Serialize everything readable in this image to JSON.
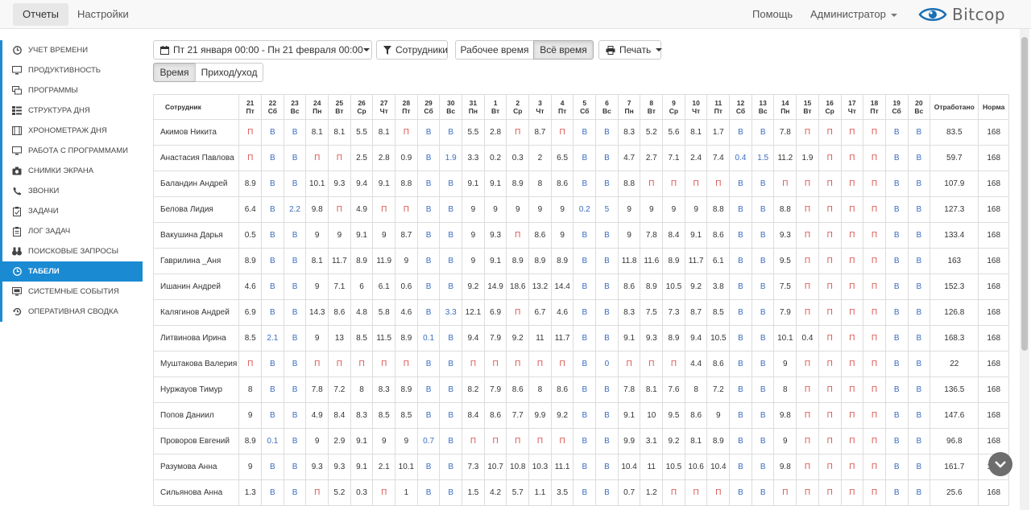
{
  "topbar": {
    "tabs": [
      "Отчеты",
      "Настройки"
    ],
    "help": "Помощь",
    "admin": "Администратор",
    "logo": "Bitcop"
  },
  "sidebar": {
    "items": [
      {
        "label": "Учет времени",
        "icon": "clock-icon"
      },
      {
        "label": "Продуктивность",
        "icon": "monitor-icon"
      },
      {
        "label": "Программы",
        "icon": "apps-icon"
      },
      {
        "label": "Структура дня",
        "icon": "list-icon"
      },
      {
        "label": "Хронометраж дня",
        "icon": "film-icon"
      },
      {
        "label": "Работа с программами",
        "icon": "monitor-icon"
      },
      {
        "label": "Снимки экрана",
        "icon": "camera-icon"
      },
      {
        "label": "Звонки",
        "icon": "phone-icon"
      },
      {
        "label": "Задачи",
        "icon": "clipboard-icon"
      },
      {
        "label": "Лог задач",
        "icon": "log-icon"
      },
      {
        "label": "Поисковые запросы",
        "icon": "binoculars-icon"
      },
      {
        "label": "Табели",
        "icon": "clock-icon"
      },
      {
        "label": "Системные события",
        "icon": "event-icon"
      },
      {
        "label": "Оперативная сводка",
        "icon": "history-icon"
      }
    ],
    "active_index": 11
  },
  "toolbar": {
    "date_range": "Пт 21 января 00:00 - Пн 21 февраля 00:00",
    "employees": "Сотрудники",
    "work_time": "Рабочее время",
    "all_time": "Всё время",
    "print": "Печать",
    "view_time": "Время",
    "view_arrival": "Приход/уход"
  },
  "table": {
    "employee_header": "Сотрудник",
    "worked_header": "Отработано",
    "norm_header": "Норма",
    "days": [
      [
        "21",
        "Пт"
      ],
      [
        "22",
        "Сб"
      ],
      [
        "23",
        "Вс"
      ],
      [
        "24",
        "Пн"
      ],
      [
        "25",
        "Вт"
      ],
      [
        "26",
        "Ср"
      ],
      [
        "27",
        "Чт"
      ],
      [
        "28",
        "Пт"
      ],
      [
        "29",
        "Сб"
      ],
      [
        "30",
        "Вс"
      ],
      [
        "31",
        "Пн"
      ],
      [
        "1",
        "Вт"
      ],
      [
        "2",
        "Ср"
      ],
      [
        "3",
        "Чт"
      ],
      [
        "4",
        "Пт"
      ],
      [
        "5",
        "Сб"
      ],
      [
        "6",
        "Вс"
      ],
      [
        "7",
        "Пн"
      ],
      [
        "8",
        "Вт"
      ],
      [
        "9",
        "Ср"
      ],
      [
        "10",
        "Чт"
      ],
      [
        "11",
        "Пт"
      ],
      [
        "12",
        "Сб"
      ],
      [
        "13",
        "Вс"
      ],
      [
        "14",
        "Пн"
      ],
      [
        "15",
        "Вт"
      ],
      [
        "16",
        "Ср"
      ],
      [
        "17",
        "Чт"
      ],
      [
        "18",
        "Пт"
      ],
      [
        "19",
        "Сб"
      ],
      [
        "20",
        "Вс"
      ]
    ],
    "rows": [
      {
        "name": "Акимов Никита",
        "cells": [
          "П",
          "В",
          "В",
          "8.1",
          "8.1",
          "5.5",
          "8.1",
          "П",
          "В",
          "В",
          "5.5",
          "2.8",
          "П",
          "8.7",
          "П",
          "В",
          "В",
          "8.3",
          "5.2",
          "5.6",
          "8.1",
          "1.7",
          "В",
          "В",
          "7.8",
          "П",
          "П",
          "П",
          "П",
          "В",
          "В"
        ],
        "worked": "83.5",
        "norm": "168"
      },
      {
        "name": "Анастасия Павлова",
        "cells": [
          "П",
          "В",
          "В",
          "П",
          "П",
          "2.5",
          "2.8",
          "0.9",
          "В",
          "1.9",
          "3.3",
          "0.2",
          "0.3",
          "2",
          "6.5",
          "В",
          "В",
          "4.7",
          "2.7",
          "7.1",
          "2.4",
          "7.4",
          "0.4",
          "1.5",
          "11.2",
          "1.9",
          "П",
          "П",
          "П",
          "В",
          "В"
        ],
        "worked": "59.7",
        "norm": "168"
      },
      {
        "name": "Баландин Андрей",
        "cells": [
          "8.9",
          "В",
          "В",
          "10.1",
          "9.3",
          "9.4",
          "9.1",
          "8.8",
          "В",
          "В",
          "9.1",
          "9.1",
          "8.9",
          "8",
          "8.6",
          "В",
          "В",
          "8.8",
          "П",
          "П",
          "П",
          "П",
          "В",
          "В",
          "П",
          "П",
          "П",
          "П",
          "П",
          "В",
          "В"
        ],
        "worked": "107.9",
        "norm": "168"
      },
      {
        "name": "Белова Лидия",
        "cells": [
          "6.4",
          "В",
          "2.2",
          "9.8",
          "П",
          "4.9",
          "П",
          "П",
          "В",
          "В",
          "9",
          "9",
          "9",
          "9",
          "9",
          "0.2",
          "5",
          "9",
          "9",
          "9",
          "9",
          "8.8",
          "В",
          "В",
          "8.8",
          "П",
          "П",
          "П",
          "П",
          "В",
          "В"
        ],
        "worked": "127.3",
        "norm": "168"
      },
      {
        "name": "Вакушина Дарья",
        "cells": [
          "0.5",
          "В",
          "В",
          "9",
          "9",
          "9.1",
          "9",
          "8.7",
          "В",
          "В",
          "9",
          "9.3",
          "П",
          "8.6",
          "9",
          "В",
          "В",
          "9",
          "7.8",
          "8.4",
          "9.1",
          "8.6",
          "В",
          "В",
          "9.3",
          "П",
          "П",
          "П",
          "П",
          "В",
          "В"
        ],
        "worked": "133.4",
        "norm": "168"
      },
      {
        "name": "Гаврилина _Аня",
        "cells": [
          "8.9",
          "В",
          "В",
          "8.1",
          "11.7",
          "8.9",
          "11.9",
          "9",
          "В",
          "В",
          "9",
          "9.1",
          "8.9",
          "8.9",
          "8.9",
          "В",
          "В",
          "11.8",
          "11.6",
          "8.9",
          "11.7",
          "6.1",
          "В",
          "В",
          "9.5",
          "П",
          "П",
          "П",
          "П",
          "В",
          "В"
        ],
        "worked": "163",
        "norm": "168"
      },
      {
        "name": "Ишанин Андрей",
        "cells": [
          "4.6",
          "В",
          "В",
          "9",
          "7.1",
          "6",
          "6.1",
          "0.6",
          "В",
          "В",
          "9.2",
          "14.9",
          "18.6",
          "13.2",
          "14.4",
          "В",
          "В",
          "8.6",
          "8.9",
          "10.5",
          "9.2",
          "3.8",
          "В",
          "В",
          "7.5",
          "П",
          "П",
          "П",
          "П",
          "В",
          "В"
        ],
        "worked": "152.3",
        "norm": "168"
      },
      {
        "name": "Калягинов Андрей",
        "cells": [
          "6.9",
          "В",
          "В",
          "14.3",
          "8.6",
          "4.8",
          "5.8",
          "4.6",
          "В",
          "3.3",
          "12.1",
          "6.9",
          "П",
          "6.7",
          "4.6",
          "В",
          "В",
          "8.3",
          "7.5",
          "7.3",
          "8.7",
          "8.5",
          "В",
          "В",
          "7.9",
          "П",
          "П",
          "П",
          "П",
          "В",
          "В"
        ],
        "worked": "126.8",
        "norm": "168"
      },
      {
        "name": "Литвинова Ирина",
        "cells": [
          "8.5",
          "2.1",
          "В",
          "9",
          "13",
          "8.5",
          "11.5",
          "8.9",
          "0.1",
          "В",
          "9.4",
          "7.9",
          "9.2",
          "11",
          "11.7",
          "В",
          "В",
          "9.1",
          "9.3",
          "8.9",
          "9.4",
          "10.5",
          "В",
          "В",
          "10.1",
          "0.4",
          "П",
          "П",
          "П",
          "В",
          "В"
        ],
        "worked": "168.3",
        "norm": "168"
      },
      {
        "name": "Муштакова Валерия",
        "cells": [
          "П",
          "В",
          "В",
          "П",
          "П",
          "П",
          "П",
          "П",
          "В",
          "В",
          "П",
          "П",
          "П",
          "П",
          "П",
          "В",
          "0",
          "П",
          "П",
          "П",
          "4.4",
          "8.6",
          "В",
          "В",
          "9",
          "П",
          "П",
          "П",
          "П",
          "В",
          "В"
        ],
        "worked": "22",
        "norm": "168"
      },
      {
        "name": "Нуржауов Тимур",
        "cells": [
          "8",
          "В",
          "В",
          "7.8",
          "7.2",
          "8",
          "8.3",
          "8.9",
          "В",
          "В",
          "8.2",
          "7.9",
          "8.6",
          "8",
          "8.6",
          "В",
          "В",
          "7.8",
          "8.1",
          "7.6",
          "8",
          "7.2",
          "В",
          "В",
          "8",
          "П",
          "П",
          "П",
          "П",
          "В",
          "В"
        ],
        "worked": "136.5",
        "norm": "168"
      },
      {
        "name": "Попов Даниил",
        "cells": [
          "9",
          "В",
          "В",
          "4.9",
          "8.4",
          "8.3",
          "8.5",
          "8.5",
          "В",
          "В",
          "8.4",
          "8.6",
          "7.7",
          "9.9",
          "9.2",
          "В",
          "В",
          "9.1",
          "10",
          "9.5",
          "8.6",
          "9",
          "В",
          "В",
          "9.8",
          "П",
          "П",
          "П",
          "П",
          "В",
          "В"
        ],
        "worked": "147.6",
        "norm": "168"
      },
      {
        "name": "Проворов Евгений",
        "cells": [
          "8.9",
          "0.1",
          "В",
          "9",
          "2.9",
          "9.1",
          "9",
          "9",
          "0.7",
          "В",
          "П",
          "П",
          "П",
          "П",
          "П",
          "В",
          "В",
          "9.9",
          "3.1",
          "9.2",
          "8.1",
          "8.9",
          "В",
          "В",
          "9",
          "П",
          "П",
          "П",
          "П",
          "В",
          "В"
        ],
        "worked": "96.8",
        "norm": "168"
      },
      {
        "name": "Разумова Анна",
        "cells": [
          "9",
          "В",
          "В",
          "9.3",
          "9.3",
          "9.1",
          "2.1",
          "10.1",
          "В",
          "В",
          "7.3",
          "10.7",
          "10.8",
          "10.3",
          "11.1",
          "В",
          "В",
          "10.4",
          "11",
          "10.5",
          "10.6",
          "10.4",
          "В",
          "В",
          "9.8",
          "П",
          "П",
          "П",
          "П",
          "В",
          "В"
        ],
        "worked": "161.7",
        "norm": "168"
      },
      {
        "name": "Сильянова Анна",
        "cells": [
          "1.3",
          "В",
          "В",
          "П",
          "5.2",
          "0.3",
          "П",
          "1",
          "В",
          "В",
          "1.5",
          "4.2",
          "5.7",
          "1.1",
          "3.5",
          "В",
          "В",
          "0.7",
          "1.2",
          "П",
          "П",
          "П",
          "В",
          "В",
          "П",
          "П",
          "П",
          "П",
          "П",
          "В",
          "В"
        ],
        "worked": "25.6",
        "norm": "168"
      }
    ]
  }
}
